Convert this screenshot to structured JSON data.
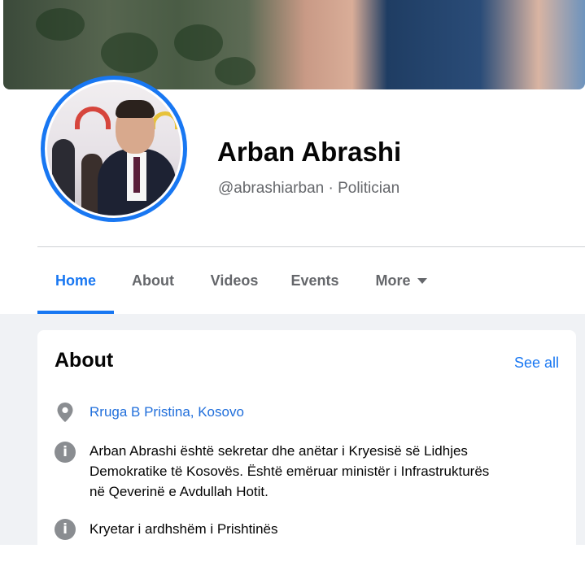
{
  "profile": {
    "name": "Arban Abrashi",
    "handle": "@abrashiarban",
    "separator": " · ",
    "category": "Politician"
  },
  "tabs": [
    {
      "label": "Home",
      "active": true
    },
    {
      "label": "About",
      "active": false
    },
    {
      "label": "Videos",
      "active": false
    },
    {
      "label": "Events",
      "active": false
    },
    {
      "label": "More",
      "active": false
    }
  ],
  "about": {
    "title": "About",
    "see_all": "See all",
    "address": "Rruga B Pristina, Kosovo",
    "bio_lines": [
      "Arban Abrashi është sekretar dhe anëtar i Kryesisë së Lidhjes",
      "Demokratike të Kosovës. Është emëruar ministër i Infrastrukturës",
      "në Qeverinë e Avdullah Hotit."
    ],
    "position": "Kryetar i ardhshëm i Prishtinës"
  },
  "icons": {
    "location": "location-pin-icon",
    "info": "info-icon",
    "more_caret": "caret-down-icon"
  },
  "colors": {
    "accent": "#1877f2",
    "link": "#216fdb",
    "secondary_text": "#65676b",
    "icon_grey": "#8a8d91",
    "background": "#f0f2f5"
  }
}
